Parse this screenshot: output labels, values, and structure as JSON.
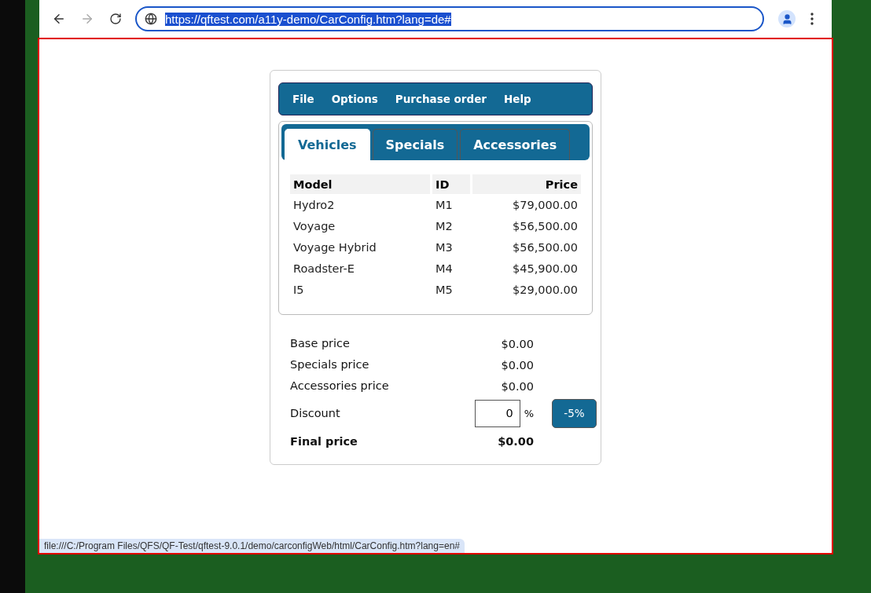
{
  "browser": {
    "url": "https://qftest.com/a11y-demo/CarConfig.htm?lang=de#",
    "forward_disabled": true
  },
  "menu": [
    {
      "label": "File"
    },
    {
      "label": "Options"
    },
    {
      "label": "Purchase order"
    },
    {
      "label": "Help"
    }
  ],
  "tabs": [
    {
      "label": "Vehicles",
      "selected": true
    },
    {
      "label": "Specials",
      "selected": false
    },
    {
      "label": "Accessories",
      "selected": false
    }
  ],
  "table": {
    "columns": [
      "Model",
      "ID",
      "Price"
    ],
    "rows": [
      [
        "Hydro2",
        "M1",
        "$79,000.00"
      ],
      [
        "Voyage",
        "M2",
        "$56,500.00"
      ],
      [
        "Voyage Hybrid",
        "M3",
        "$56,500.00"
      ],
      [
        "Roadster-E",
        "M4",
        "$45,900.00"
      ],
      [
        "I5",
        "M5",
        "$29,000.00"
      ]
    ]
  },
  "summary": [
    {
      "label": "Base price",
      "value": "$0.00"
    },
    {
      "label": "Specials price",
      "value": "$0.00"
    },
    {
      "label": "Accessories price",
      "value": "$0.00"
    }
  ],
  "discount": {
    "label": "Discount",
    "value": "0",
    "unit": "%",
    "button": "-5%"
  },
  "final": {
    "label": "Final price",
    "value": "$0.00"
  },
  "status_bar": "file:///C:/Program Files/QFS/QF-Test/qftest-9.0.1/demo/carconfigWeb/html/CarConfig.htm?lang=en#"
}
